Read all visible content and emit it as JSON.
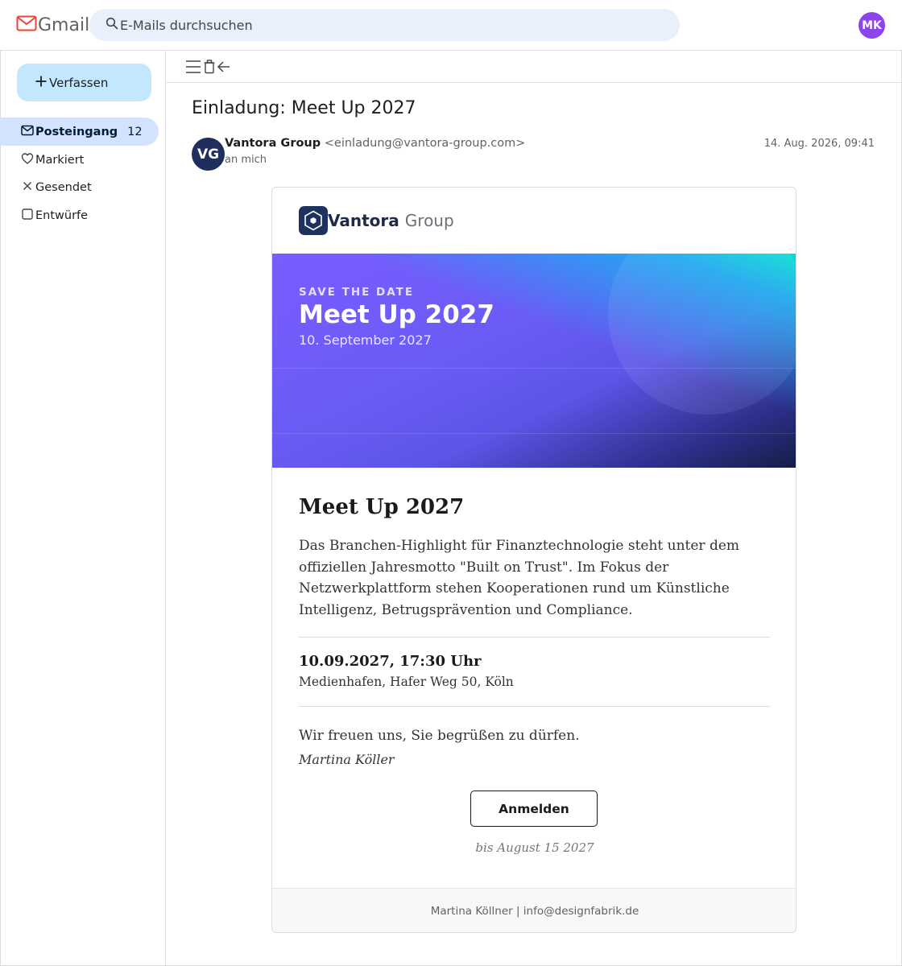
{
  "app": {
    "name": "Gmail"
  },
  "search": {
    "placeholder": "E-Mails durchsuchen"
  },
  "user": {
    "initials": "MK",
    "avatar_color": "#8e44ec"
  },
  "sidebar": {
    "compose_label": "Verfassen",
    "items": [
      {
        "label": "Posteingang",
        "count": "12",
        "icon": "inbox-icon",
        "active": true
      },
      {
        "label": "Markiert",
        "icon": "star-icon"
      },
      {
        "label": "Gesendet",
        "icon": "sent-icon"
      },
      {
        "label": "Entwürfe",
        "icon": "drafts-icon"
      }
    ]
  },
  "toolbar": {
    "icons": [
      "menu-icon",
      "delete-icon",
      "back-icon"
    ]
  },
  "message": {
    "subject": "Einladung: Meet Up 2027",
    "sender_initials": "VG",
    "sender_name": "Vantora Group",
    "sender_email": "<einladung@vantora-group.com>",
    "recipient": "an mich",
    "date": "14. Aug. 2026, 09:41"
  },
  "email": {
    "brand_name": "Vantora",
    "brand_suffix": "Group",
    "hero": {
      "eyebrow": "SAVE THE DATE",
      "title": "Meet Up 2027",
      "date": "10. September 2027"
    },
    "title": "Meet Up 2027",
    "body": "Das Branchen-Highlight für Finanztechnologie steht unter dem offiziellen Jahresmotto \"Built on Trust\". Im Fokus der Netzwerkplattform stehen Kooperationen rund um Künstliche Intelligenz, Betrugsprävention und Compliance.",
    "event_time": "10.09.2027, 17:30 Uhr",
    "event_place": "Medienhafen, Hafer Weg 50, Köln",
    "greeting": "Wir freuen uns, Sie begrüßen zu dürfen.",
    "signature": "Martina Köller",
    "cta_label": "Anmelden",
    "deadline": "bis August 15 2027",
    "footer": "Martina Köllner | info@designfabrik.de"
  },
  "colors": {
    "compose_bg": "#c2e7ff",
    "active_nav_bg": "#d3e3fd",
    "search_bg": "#e9f0fb",
    "brand_dark": "#1e3260",
    "hero_purple": "#6a5cf6",
    "hero_cyan": "#00e8d0"
  }
}
